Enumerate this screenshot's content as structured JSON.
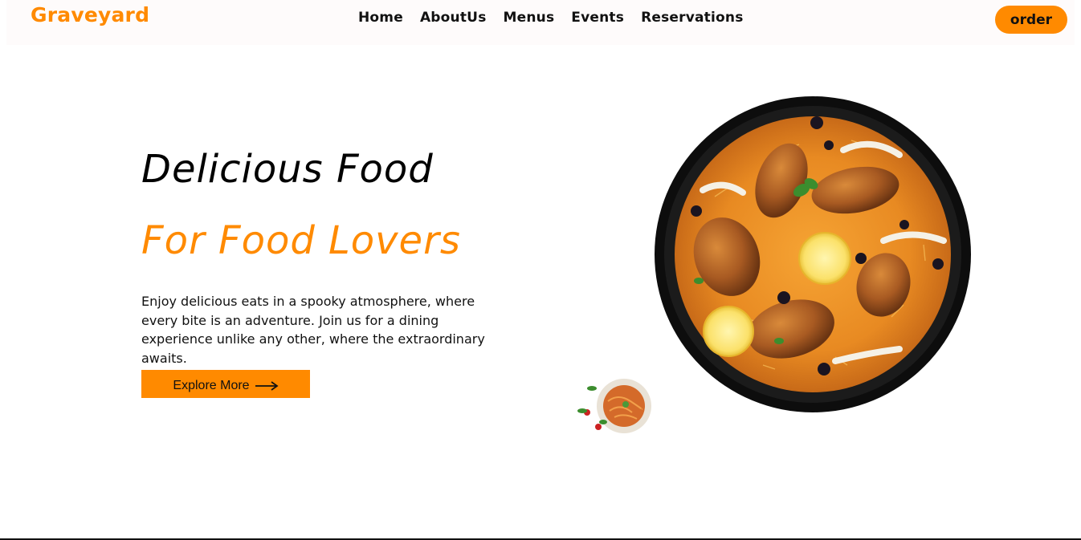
{
  "navbar": {
    "logo": "Graveyard",
    "links": [
      "Home",
      "AboutUs",
      "Menus",
      "Events",
      "Reservations"
    ],
    "order_label": "order"
  },
  "hero": {
    "title": "Delicious  Food",
    "subtitle": "For  Food  Lovers",
    "description": "Enjoy delicious eats in a spooky atmosphere, where every bite is an adventure. Join us for a dining experience unlike any other, where the extraordinary awaits.",
    "cta_label": "Explore More",
    "cta_icon": "arrow-right-icon"
  },
  "images": {
    "main": "biryani-bowl-image",
    "secondary": "noodle-plate-image"
  },
  "colors": {
    "accent": "#ff8a00",
    "text": "#111111",
    "navbar_bg": "#fefbfb"
  }
}
